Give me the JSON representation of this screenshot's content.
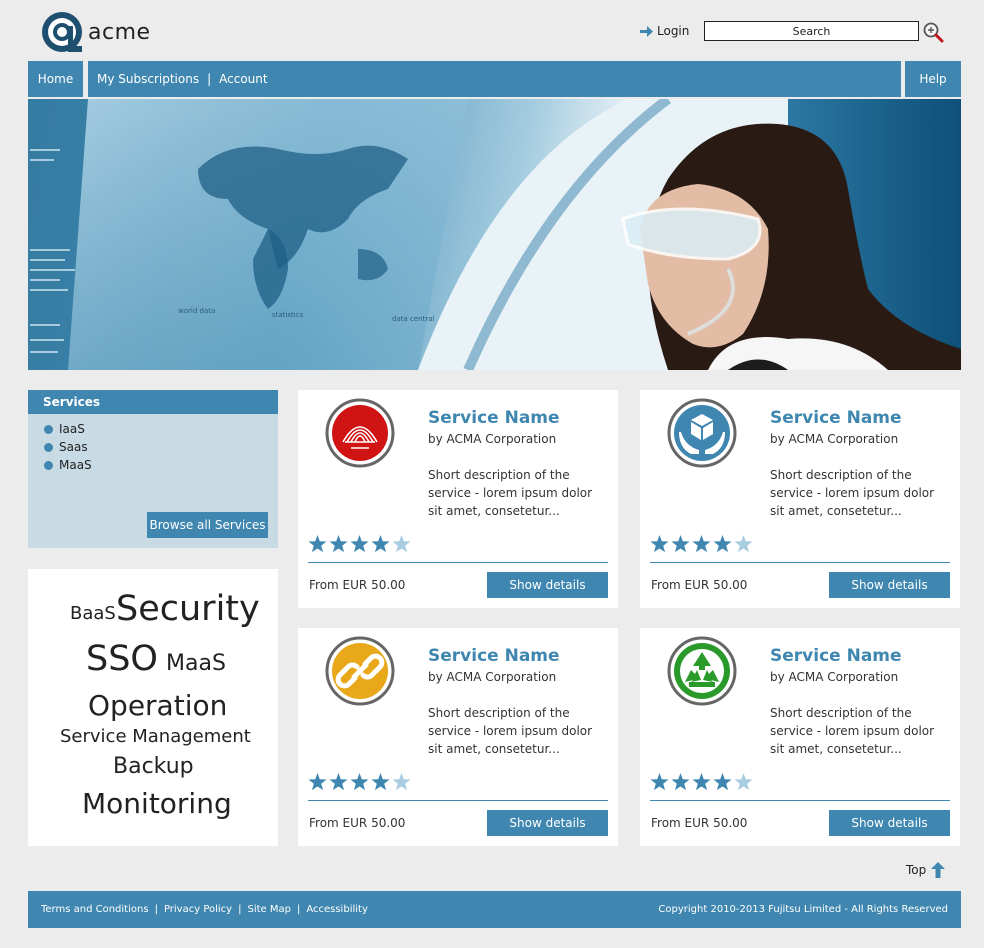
{
  "header": {
    "logo_text": "acme",
    "login_label": "Login",
    "search_placeholder": "Search"
  },
  "nav": {
    "home": "Home",
    "subscriptions": "My Subscriptions",
    "separator": "|",
    "account": "Account",
    "help": "Help"
  },
  "hero": {
    "screen_texts": [
      "world data",
      "statistics",
      "data central"
    ]
  },
  "services_panel": {
    "title": "Services",
    "items": [
      "IaaS",
      "Saas",
      "MaaS"
    ],
    "browse_label": "Browse all Services"
  },
  "tag_cloud": {
    "tags": [
      "BaaS",
      "Security",
      "SSO",
      "MaaS",
      "Operation",
      "Service Management",
      "Backup",
      "Monitoring"
    ]
  },
  "cards": [
    {
      "title": "Service Name",
      "vendor": "by ACMA Corporation",
      "description": "Short description of the service - lorem ipsum dolor sit amet, consetetur...",
      "price": "From EUR 50.00",
      "button": "Show details",
      "rating": 4,
      "icon": "spring-icon",
      "icon_color": "#d01414"
    },
    {
      "title": "Service Name",
      "vendor": "by ACMA Corporation",
      "description": "Short description of the service - lorem ipsum dolor sit amet, consetetur...",
      "price": "From EUR 50.00",
      "button": "Show details",
      "rating": 4,
      "icon": "box-hands-icon",
      "icon_color": "#3f87b0"
    },
    {
      "title": "Service Name",
      "vendor": "by ACMA Corporation",
      "description": "Short description of the service - lorem ipsum dolor sit amet, consetetur...",
      "price": "From EUR 50.00",
      "button": "Show details",
      "rating": 4,
      "icon": "chain-link-icon",
      "icon_color": "#e8a81a"
    },
    {
      "title": "Service Name",
      "vendor": "by ACMA Corporation",
      "description": "Short description of the service - lorem ipsum dolor sit amet, consetetur...",
      "price": "From EUR 50.00",
      "button": "Show details",
      "rating": 4,
      "icon": "recycle-icon",
      "icon_color": "#2a9a2a"
    }
  ],
  "top_link": "Top",
  "footer": {
    "links": [
      "Terms and Conditions",
      "Privacy Policy",
      "Site Map",
      "Accessibility"
    ],
    "separator": "|",
    "copyright": "Copyright 2010-2013 Fujitsu Limited - All Rights Reserved"
  },
  "colors": {
    "accent": "#3f87b0",
    "panel_bg": "#c8dbe5",
    "page_bg": "#ececec"
  }
}
